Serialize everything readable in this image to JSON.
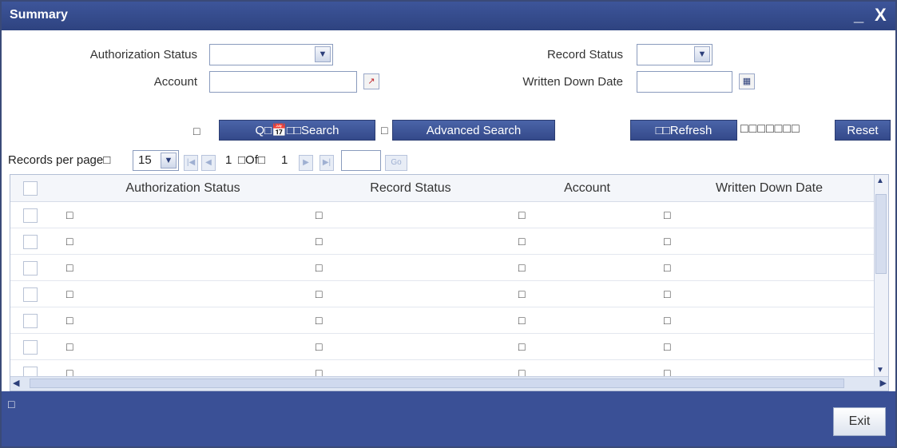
{
  "window": {
    "title": "Summary",
    "minimize_label": "_",
    "close_label": "X"
  },
  "filters": {
    "authorization_status_label": "Authorization Status",
    "authorization_status_value": "",
    "account_label": "Account",
    "account_value": "",
    "record_status_label": "Record Status",
    "record_status_value": "",
    "written_down_date_label": "Written Down Date",
    "written_down_date_value": ""
  },
  "actions": {
    "leading_mark": "□",
    "search_label": "Q□📅□□Search",
    "separator_mark": "□",
    "advanced_search_label": "Advanced Search",
    "refresh_label": "□□Refresh",
    "reset_prefix": "□□□□□□□",
    "reset_label": "Reset"
  },
  "pager": {
    "records_per_page_label": "Records per page□",
    "records_per_page_value": "15",
    "current_page": "1",
    "of_label": "□Of□",
    "total_pages": "1",
    "goto_value": "",
    "go_label": "Go"
  },
  "grid": {
    "columns": [
      "Authorization Status",
      "Record Status",
      "Account",
      "Written Down Date"
    ],
    "rows": [
      [
        "□",
        "□",
        "□",
        "□"
      ],
      [
        "□",
        "□",
        "□",
        "□"
      ],
      [
        "□",
        "□",
        "□",
        "□"
      ],
      [
        "□",
        "□",
        "□",
        "□"
      ],
      [
        "□",
        "□",
        "□",
        "□"
      ],
      [
        "□",
        "□",
        "□",
        "□"
      ],
      [
        "□",
        "□",
        "□",
        "□"
      ]
    ]
  },
  "footer": {
    "status_mark": "□",
    "exit_label": "Exit"
  },
  "colors": {
    "titlebar": "#2e4380",
    "button": "#34498a",
    "footer": "#3a5096"
  },
  "icons": [
    "chevron-down-icon",
    "lookup-icon",
    "calendar-icon",
    "first-page-icon",
    "prev-page-icon",
    "next-page-icon",
    "last-page-icon"
  ]
}
